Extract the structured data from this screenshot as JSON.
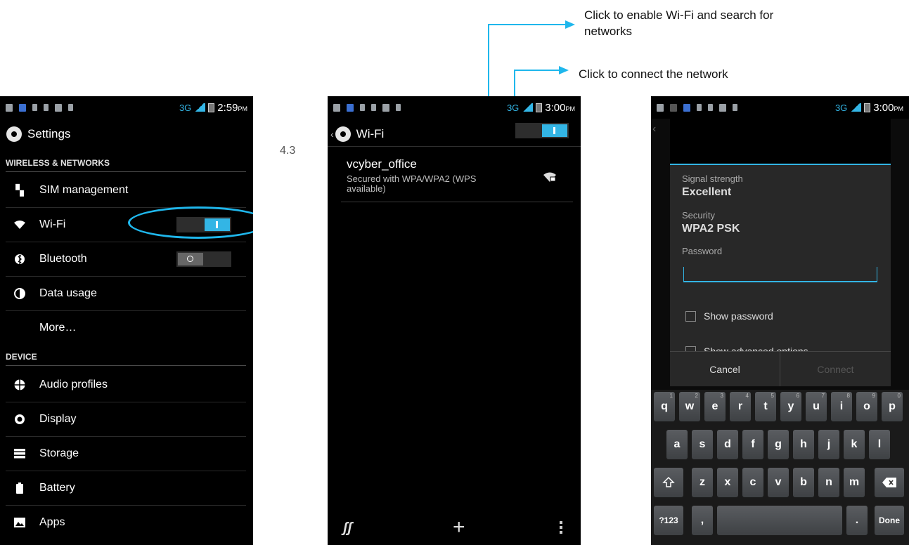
{
  "annotations": {
    "enable_wifi": "Click to enable Wi-Fi and search for networks",
    "connect_network": "Click to connect the network",
    "step_label": "4.3"
  },
  "phone1": {
    "status": {
      "network": "3G",
      "time": "2:59",
      "ampm": "PM"
    },
    "title": "Settings",
    "sections": [
      {
        "header": "WIRELESS & NETWORKS",
        "items": [
          {
            "label": "SIM management",
            "icon": "sim-settings-icon"
          },
          {
            "label": "Wi-Fi",
            "icon": "wifi-icon",
            "toggle": "on"
          },
          {
            "label": "Bluetooth",
            "icon": "bluetooth-icon",
            "toggle": "off"
          },
          {
            "label": "Data usage",
            "icon": "data-usage-icon"
          },
          {
            "label": "More…",
            "icon": ""
          }
        ]
      },
      {
        "header": "DEVICE",
        "items": [
          {
            "label": "Audio profiles",
            "icon": "audio-profiles-icon"
          },
          {
            "label": "Display",
            "icon": "display-icon"
          },
          {
            "label": "Storage",
            "icon": "storage-icon"
          },
          {
            "label": "Battery",
            "icon": "battery-icon"
          },
          {
            "label": "Apps",
            "icon": "apps-icon"
          }
        ]
      }
    ]
  },
  "phone2": {
    "status": {
      "network": "3G",
      "time": "3:00",
      "ampm": "PM"
    },
    "title": "Wi-Fi",
    "network": {
      "ssid": "vcyber_office",
      "security": "Secured with WPA/WPA2 (WPS available)"
    }
  },
  "phone3": {
    "status": {
      "network": "3G",
      "time": "3:00",
      "ampm": "PM"
    },
    "dialog": {
      "signal_label": "Signal strength",
      "signal_value": "Excellent",
      "security_label": "Security",
      "security_value": "WPA2 PSK",
      "password_label": "Password",
      "password_value": "",
      "show_password": "Show password",
      "show_advanced": "Show advanced options",
      "cancel": "Cancel",
      "connect": "Connect"
    },
    "keyboard": {
      "row1": [
        [
          "q",
          "1"
        ],
        [
          "w",
          "2"
        ],
        [
          "e",
          "3"
        ],
        [
          "r",
          "4"
        ],
        [
          "t",
          "5"
        ],
        [
          "y",
          "6"
        ],
        [
          "u",
          "7"
        ],
        [
          "i",
          "8"
        ],
        [
          "o",
          "9"
        ],
        [
          "p",
          "0"
        ]
      ],
      "row2": [
        "a",
        "s",
        "d",
        "f",
        "g",
        "h",
        "j",
        "k",
        "l"
      ],
      "row3": [
        "z",
        "x",
        "c",
        "v",
        "b",
        "n",
        "m"
      ],
      "sym": "?123",
      "comma": ",",
      "period": ".",
      "done": "Done"
    }
  },
  "colors": {
    "accent": "#33b5e5",
    "annotation": "#1fb7ec"
  }
}
